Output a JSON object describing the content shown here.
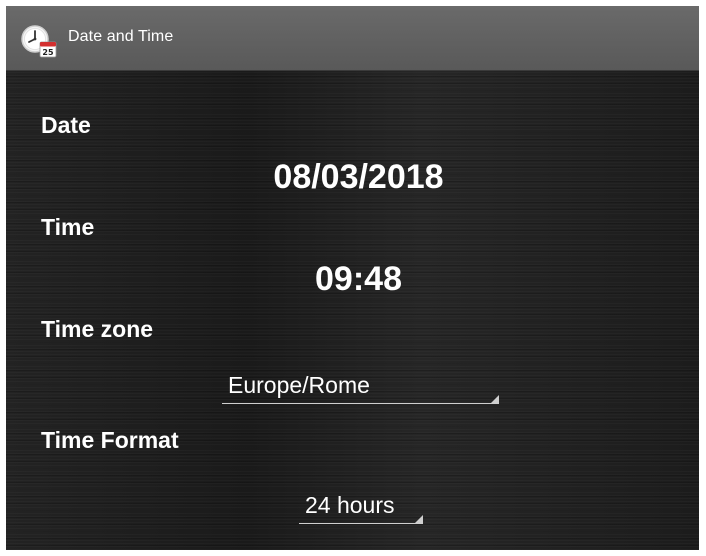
{
  "window": {
    "title": "Date and Time",
    "icon": "clock-calendar-icon",
    "calendar_badge": "25"
  },
  "colors": {
    "titlebar": "#5f5f5f",
    "background": "#1e1e1e",
    "text": "#ffffff",
    "underline": "#cfcfcf"
  },
  "date": {
    "label": "Date",
    "value": "08/03/2018"
  },
  "time": {
    "label": "Time",
    "value": "09:48"
  },
  "timezone": {
    "label": "Time zone",
    "selected": "Europe/Rome"
  },
  "time_format": {
    "label": "Time Format",
    "selected": "24 hours"
  }
}
